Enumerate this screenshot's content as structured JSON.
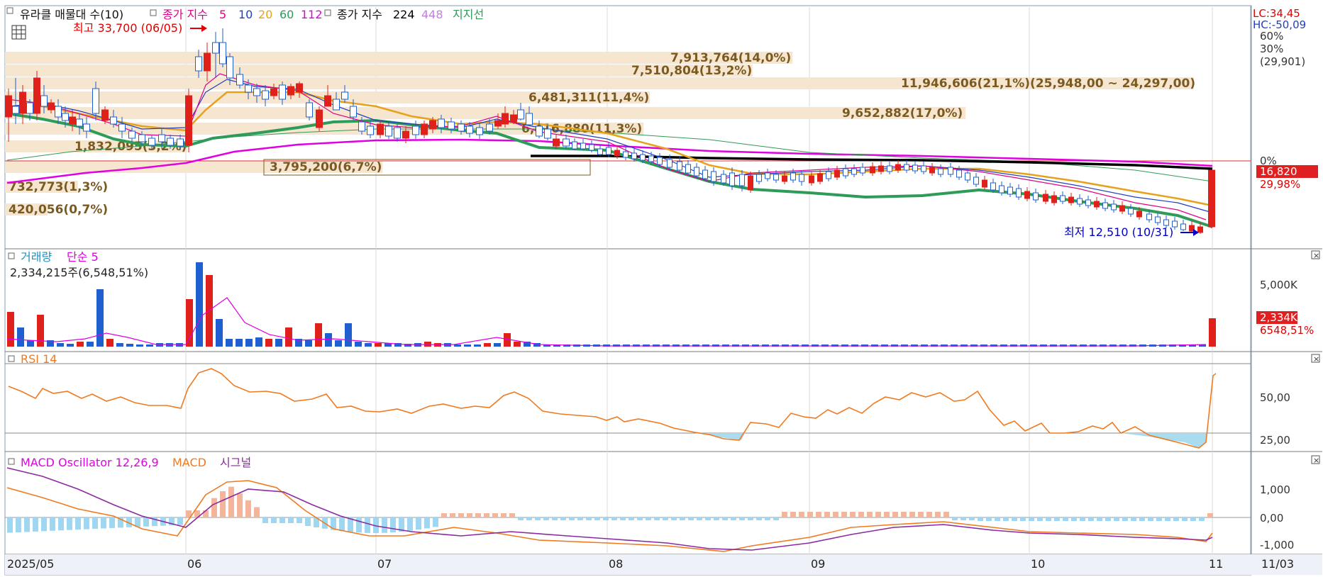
{
  "price_panel": {
    "legend": {
      "volume_profile": "유라클 매물대 수(10)",
      "ma_prefix": "종가 지수",
      "ma_periods": [
        "5",
        "10",
        "20",
        "60",
        "112"
      ],
      "ma_colors": [
        "#e0008a",
        "#1f3fbf",
        "#e6a21a",
        "#2e9b58",
        "#e000e0"
      ],
      "ma2_prefix": "종가 지수",
      "ma2_periods": [
        "224",
        "448"
      ],
      "ma2_colors": [
        "#000000",
        "#c080e0"
      ],
      "support_line": "지지선"
    },
    "high_label": "최고 33,700 (06/05)",
    "low_label": "최저 12,510 (10/31)",
    "right_top": {
      "lc": "LC:34,45",
      "hc": "HC:-50,09"
    },
    "axis_right": [
      "60%",
      "30%",
      "(29,901)",
      "0%"
    ],
    "current_price": "16,820",
    "current_pct": "29,98%",
    "volume_profile_bars": [
      {
        "label": "7,913,764(14,0%)",
        "value": 7913764
      },
      {
        "label": "7,510,804(13,2%)",
        "value": 7510804
      },
      {
        "label": "11,946,606(21,1%)(25,948,00 ~ 24,297,00)",
        "value": 11946606
      },
      {
        "label": "6,481,311(11,4%)",
        "value": 6481311
      },
      {
        "label": "9,652,882(17,0%)",
        "value": 9652882
      },
      {
        "label": "6,416,880(11,3%)",
        "value": 6416880
      },
      {
        "label": "1,832,095(3,2%)",
        "value": 1832095
      },
      {
        "label": "3,795,200(6,7%)",
        "value": 3795200
      },
      {
        "label": "732,773(1,3%)",
        "value": 732773
      },
      {
        "label": "420,056(0,7%)",
        "value": 420056
      }
    ]
  },
  "volume_panel": {
    "legend": {
      "title": "거래량",
      "ma": "단순 5"
    },
    "current": "2,334,215주(6,548,51%)",
    "axis_right": [
      "5,000K"
    ],
    "current_value": "2,334K",
    "current_pct": "6548,51%"
  },
  "rsi_panel": {
    "legend": "RSI 14",
    "axis_right": [
      "50,00",
      "25,00"
    ]
  },
  "macd_panel": {
    "legend": {
      "osc": "MACD Oscillator 12,26,9",
      "macd": "MACD",
      "signal": "시그널"
    },
    "axis_right": [
      "1,000",
      "0,00",
      "-1,000"
    ]
  },
  "x_axis": [
    "2025/05",
    "06",
    "07",
    "08",
    "09",
    "10",
    "11",
    "11/03"
  ],
  "chart_data": [
    {
      "type": "candlestick",
      "title": "",
      "x": [
        "2025/05",
        "06",
        "07",
        "08",
        "09",
        "10",
        "11"
      ],
      "series": [
        {
          "name": "종가 지수 5",
          "values": [
            27500,
            25500,
            30800,
            28200,
            27000,
            26800,
            23600,
            22900,
            21500,
            21000,
            19600,
            19300,
            18600,
            17200,
            14600,
            13500,
            16820
          ]
        },
        {
          "name": "종가 지수 224",
          "values": [
            23500,
            23500,
            23400,
            23300,
            23200,
            23100
          ]
        }
      ],
      "highlights": {
        "high": 33700,
        "high_date": "06/05",
        "low": 12510,
        "low_date": "10/31",
        "last": 16820
      },
      "volume_profile": [
        7913764,
        7510804,
        11946606,
        6481311,
        9652882,
        6416880,
        1832095,
        3795200,
        732773,
        420056
      ]
    },
    {
      "type": "bar",
      "title": "",
      "series": [
        {
          "name": "거래량",
          "values": [
            2334215
          ]
        }
      ]
    },
    {
      "type": "line",
      "title": "",
      "series": [
        {
          "name": "RSI 14",
          "values": [
            51,
            57,
            48,
            45,
            40,
            69,
            60,
            52,
            44,
            51,
            56,
            60,
            55,
            44,
            40,
            34,
            25,
            37,
            50,
            52,
            46,
            40,
            30,
            33,
            29,
            20,
            63
          ]
        }
      ],
      "ylim": [
        0,
        100
      ]
    },
    {
      "type": "bar",
      "title": "",
      "series": [
        {
          "name": "MACD Oscillator 12,26,9",
          "values": [
            -600,
            -400,
            -200,
            800,
            400,
            -500,
            -300,
            100,
            -100,
            150,
            -100,
            -50,
            120
          ]
        },
        {
          "name": "MACD",
          "values": [
            1100,
            400,
            -400,
            1200,
            200,
            -700,
            -900,
            -1000,
            -700,
            -200,
            -500,
            -900,
            -700
          ]
        },
        {
          "name": "시그널",
          "values": [
            1500,
            800,
            0,
            900,
            500,
            -500,
            -800,
            -900,
            -600,
            -300,
            -500,
            -800,
            -700
          ]
        }
      ]
    }
  ]
}
